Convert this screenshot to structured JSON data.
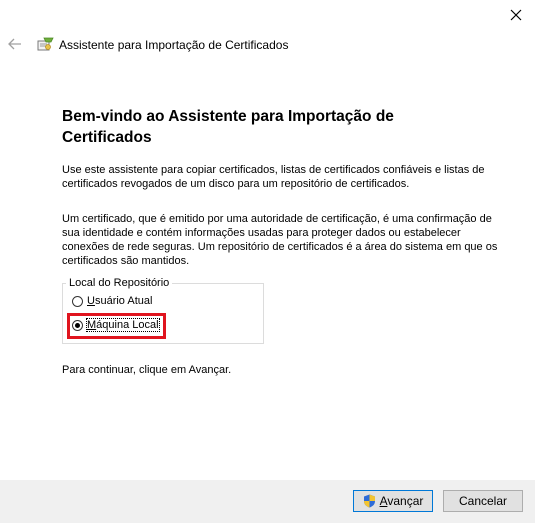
{
  "window": {
    "title": "Assistente para Importação de Certificados",
    "close_glyph": "✕",
    "back_glyph": "←"
  },
  "main": {
    "heading": "Bem-vindo ao Assistente para Importação de Certificados",
    "paragraph1": "Use este assistente para copiar certificados, listas de certificados confiáveis e listas de certificados revogados de um disco para um repositório de certificados.",
    "paragraph2": "Um certificado, que é emitido por uma autoridade de certificação, é uma confirmação de sua identidade e contém informações usadas para proteger dados ou estabelecer conexões de rede seguras. Um repositório de certificados é a área do sistema em que os certificados são mantidos.",
    "store_group": {
      "legend": "Local do Repositório",
      "options": [
        {
          "label_first": "U",
          "label_rest": "suário Atual",
          "selected": false
        },
        {
          "label_first": "M",
          "label_rest": "áquina Local",
          "selected": true
        }
      ]
    },
    "continue_text": "Para continuar, clique em Avançar."
  },
  "footer": {
    "next_first": "A",
    "next_rest": "vançar",
    "cancel_label": "Cancelar"
  },
  "colors": {
    "highlight": "#e0141e",
    "footer_bg": "#f0f0f0",
    "button_focus": "#0078d7"
  }
}
